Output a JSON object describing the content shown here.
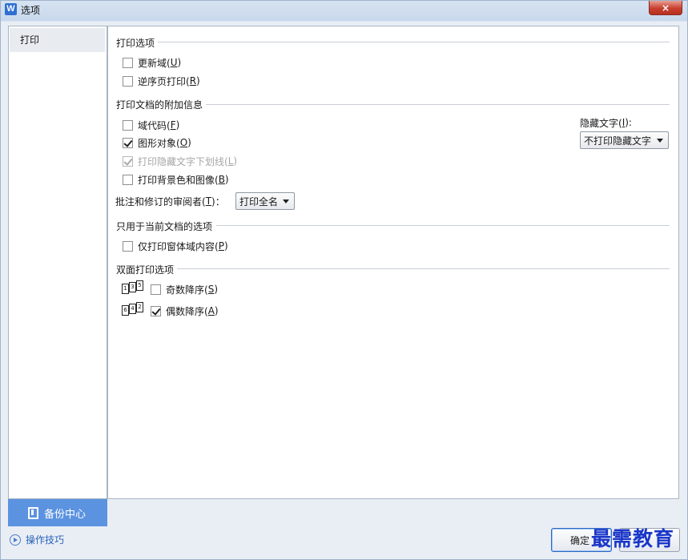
{
  "window": {
    "title": "选项",
    "app_icon_letter": "W",
    "close_label": "×"
  },
  "sidebar": {
    "items": [
      {
        "label": "打印",
        "selected": true
      }
    ],
    "backup_label": "备份中心",
    "tips_label": "操作技巧"
  },
  "print_options": {
    "title": "打印选项",
    "update_fields": {
      "label": "更新域(",
      "key": "U",
      "end": ")",
      "checked": false
    },
    "reverse_order": {
      "label": "逆序页打印(",
      "key": "R",
      "end": ")",
      "checked": false
    }
  },
  "extra_info": {
    "title": "打印文档的附加信息",
    "field_codes": {
      "label": "域代码(",
      "key": "F",
      "end": ")",
      "checked": false
    },
    "drawing_objects": {
      "label": "图形对象(",
      "key": "O",
      "end": ")",
      "checked": true
    },
    "hidden_underline": {
      "label": "打印隐藏文字下划线(",
      "key": "L",
      "end": ")",
      "checked": true,
      "disabled": true
    },
    "background": {
      "label": "打印背景色和图像(",
      "key": "B",
      "end": ")",
      "checked": false
    },
    "reviewer": {
      "label": "批注和修订的审阅者(",
      "key": "T",
      "end": ")：",
      "value": "打印全名"
    },
    "hidden_text": {
      "label": "隐藏文字(",
      "key": "I",
      "end": "):",
      "value": "不打印隐藏文字"
    }
  },
  "current_doc": {
    "title": "只用于当前文档的选项",
    "form_fields_only": {
      "label": "仅打印窗体域内容(",
      "key": "P",
      "end": ")",
      "checked": false
    }
  },
  "duplex": {
    "title": "双面打印选项",
    "odd_reverse": {
      "label": "奇数降序(",
      "key": "S",
      "end": ")",
      "checked": false,
      "pages": [
        "1",
        "3",
        "5"
      ]
    },
    "even_reverse": {
      "label": "偶数降序(",
      "key": "A",
      "end": ")",
      "checked": true,
      "pages": [
        "6",
        "4",
        "2"
      ]
    }
  },
  "footer": {
    "ok_label": "确定",
    "watermark": "最需教育"
  }
}
